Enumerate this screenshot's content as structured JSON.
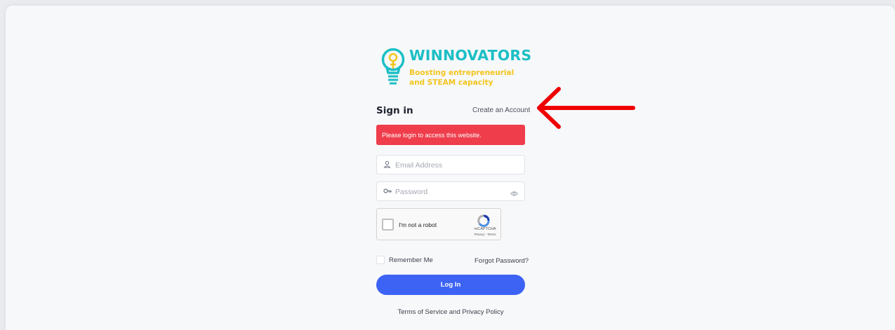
{
  "brand": {
    "title": "WINNOVATORS",
    "tagline_line1": "Boosting entrepreneurial",
    "tagline_line2": "and STEAM capacity",
    "colors": {
      "primary": "#1bbfc5",
      "secondary": "#f3c51c"
    }
  },
  "signin": {
    "title": "Sign in",
    "create_account": "Create an Account"
  },
  "alert": {
    "message": "Please login to access this website.",
    "color": "#ef3d4c"
  },
  "form": {
    "email": {
      "placeholder": "Email Address",
      "value": "",
      "icon": "user-icon"
    },
    "password": {
      "placeholder": "Password",
      "value": "",
      "icon": "key-icon",
      "toggle_icon": "eye-icon"
    },
    "captcha": {
      "label": "I'm not a robot",
      "brand": "reCAPTCHA",
      "links": "Privacy - Terms",
      "checked": false
    },
    "remember_label": "Remember Me",
    "remember_checked": false,
    "forgot_label": "Forgot Password?",
    "submit_label": "Log In",
    "submit_color": "#3d63f5"
  },
  "footer": {
    "terms": "Terms of Service and Privacy Policy"
  },
  "annotation": {
    "type": "arrow",
    "color": "#ee0000",
    "points_to": "create-account-link"
  }
}
